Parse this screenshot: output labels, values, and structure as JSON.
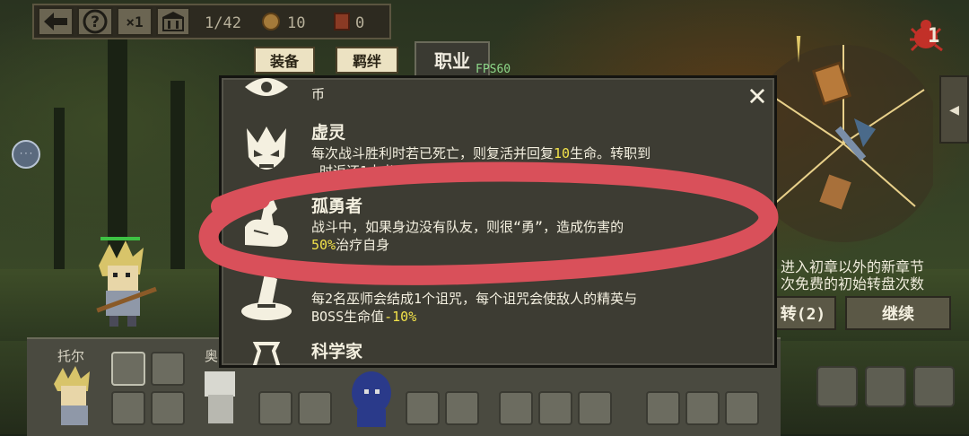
{
  "hud": {
    "back_icon": "arrow-left-icon",
    "help_icon": "question-icon",
    "speed_label": "×1",
    "book_label": "卌",
    "progress": "1/42",
    "coins": "10",
    "scrolls": "0"
  },
  "tabs": [
    {
      "label": "装备"
    },
    {
      "label": "羁绊"
    },
    {
      "label": "职业"
    }
  ],
  "fps": "FPS60",
  "panel": {
    "close_label": "✕",
    "top_cut_text": "币",
    "jobs": [
      {
        "name": "虚灵",
        "desc_parts": [
          "每次战斗胜利时若已死亡，则复活并回复",
          "10",
          "生命。转职到"
        ],
        "desc_line2": "…时返还1本书"
      },
      {
        "name": "孤勇者",
        "desc_line1": "战斗中，如果身边没有队友，则很“勇”，造成伤害的",
        "desc_hl": "50%",
        "desc_line2_rest": "治疗自身"
      },
      {
        "name": "",
        "desc_line1": "每2名巫师会结成1个诅咒，每个诅咒会使敌人的精英与",
        "desc_line2_pre": "BOSS生命值",
        "desc_hl": "-10%"
      },
      {
        "name": "科学家",
        "desc_line1": ""
      }
    ]
  },
  "right": {
    "bug_count": "1",
    "side_line1": "进入初章以外的新章节",
    "side_line2": "次免费的初始转盘次数",
    "spin_label": "转(2)",
    "continue_label": "继续"
  },
  "party": {
    "members": [
      {
        "name": "托尔"
      },
      {
        "name": "奥"
      }
    ]
  },
  "colors": {
    "highlight": "#f2e24a",
    "circle_mark": "#d9505a",
    "panel_bg": "#3d3c33"
  }
}
